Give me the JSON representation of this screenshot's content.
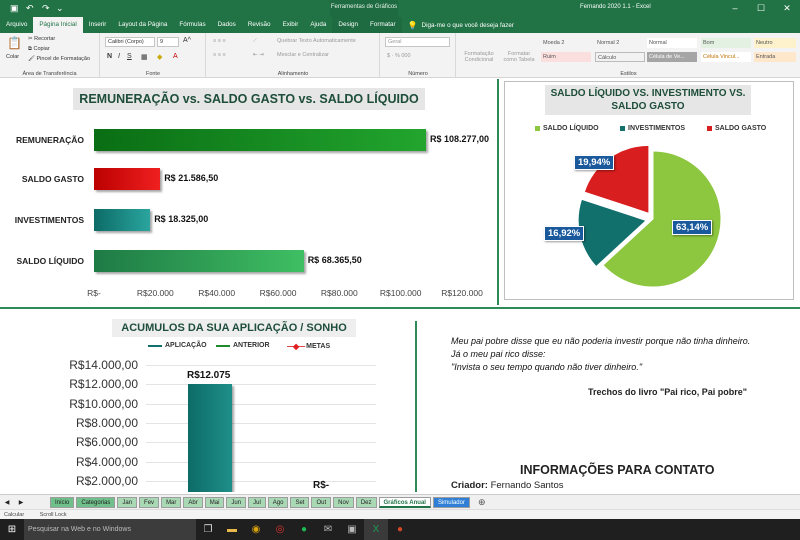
{
  "titlebar": {
    "context_group": "Ferramentas de Gráficos",
    "window_title": "Fernando 2020 1.1  -  Excel"
  },
  "tabs": [
    "Arquivo",
    "Página Inicial",
    "Inserir",
    "Layout da Página",
    "Fórmulas",
    "Dados",
    "Revisão",
    "Exibir",
    "Ajuda",
    "Design",
    "Formatar"
  ],
  "tell_me": "Diga-me o que você deseja fazer",
  "ribbon": {
    "clipboard": {
      "paste": "Colar",
      "cut": "Recortar",
      "copy": "Copiar",
      "painter": "Pincel de Formatação",
      "label": "Área de Transferência"
    },
    "font": {
      "name": "Calibri (Corpo)",
      "size": "9",
      "label": "Fonte"
    },
    "alignment": {
      "wrap": "Quebrar Texto Automaticamente",
      "merge": "Mesclar e Centralizar",
      "label": "Alinhamento"
    },
    "number": {
      "format": "Geral",
      "label": "Número"
    },
    "styles": {
      "cond": "Formatação Condicional",
      "table": "Formatar como Tabela",
      "label": "Estilos",
      "cells": [
        "Moeda 2",
        "Normal 2",
        "Normal",
        "Bom",
        "Neutro",
        "Ruim",
        "Cálculo",
        "Célula de Ve...",
        "Célula Vincul...",
        "Entrada"
      ]
    }
  },
  "chart1": {
    "title": "REMUNERAÇÃO vs. SALDO GASTO vs. SALDO LÍQUIDO",
    "chart_data": {
      "type": "bar",
      "categories": [
        "REMUNERAÇÃO",
        "SALDO GASTO",
        "INVESTIMENTOS",
        "SALDO LÍQUIDO"
      ],
      "values": [
        108277,
        21586.5,
        18325,
        68365.5
      ],
      "value_labels": [
        "R$ 108.277,00",
        "R$ 21.586,50",
        "R$ 18.325,00",
        "R$ 68.365,50"
      ],
      "xlim": [
        0,
        120000
      ],
      "x_ticks": [
        "R$-",
        "R$20.000",
        "R$40.000",
        "R$60.000",
        "R$80.000",
        "R$100.000",
        "R$120.000"
      ],
      "colors": [
        "#0e7d1a",
        "#d01010",
        "#17837c",
        "#2e8b57"
      ]
    }
  },
  "chart2": {
    "title": "SALDO LÍQUIDO VS. INVESTIMENTO VS. SALDO GASTO",
    "chart_data": {
      "type": "pie",
      "labels": [
        "SALDO LÍQUIDO",
        "INVESTIMENTOS",
        "SALDO GASTO"
      ],
      "values": [
        63.14,
        16.92,
        19.94
      ],
      "value_labels": [
        "63,14%",
        "16,92%",
        "19,94%"
      ],
      "colors": [
        "#8dc63f",
        "#12706c",
        "#d81e1e"
      ],
      "legend": "top"
    }
  },
  "chart3": {
    "title": "ACUMULOS DA SUA APLICAÇÃO / SONHO",
    "chart_data": {
      "type": "bar",
      "series": [
        {
          "name": "APLICAÇÃO",
          "values": [
            12075,
            0
          ]
        },
        {
          "name": "ANTERIOR",
          "values": []
        },
        {
          "name": "METAS",
          "values": []
        }
      ],
      "value_labels": [
        "R$12.075",
        "R$-"
      ],
      "y_ticks": [
        "R$14.000,00",
        "R$12.000,00",
        "R$10.000,00",
        "R$8.000,00",
        "R$6.000,00",
        "R$4.000,00",
        "R$2.000,00",
        "R$-"
      ],
      "ylim": [
        0,
        14000
      ],
      "colors": [
        "#12706c",
        "#1e8a2a",
        "#e02020"
      ]
    }
  },
  "quote": {
    "line1": "Meu pai pobre disse que eu não poderia investir porque não tinha dinheiro.",
    "line2": "Já o meu pai rico disse:",
    "line3": "\"Invista o seu tempo quando não tiver dinheiro.\"",
    "source": "Trechos do livro \"Pai rico, Pai pobre\""
  },
  "contact": {
    "heading": "INFORMAÇÕES PARA CONTATO",
    "creator_label": "Criador:",
    "creator": "Fernando Santos"
  },
  "sheet_tabs": [
    "Início",
    "Categorias",
    "Jan",
    "Fev",
    "Mar",
    "Abr",
    "Mai",
    "Jun",
    "Jul",
    "Ago",
    "Set",
    "Out",
    "Nov",
    "Dez",
    "Gráficos Anual",
    "Simulador"
  ],
  "status": {
    "left": "Calcular",
    "scroll": "Scroll Lock"
  },
  "taskbar": {
    "search_placeholder": "Pesquisar na Web e no Windows"
  }
}
